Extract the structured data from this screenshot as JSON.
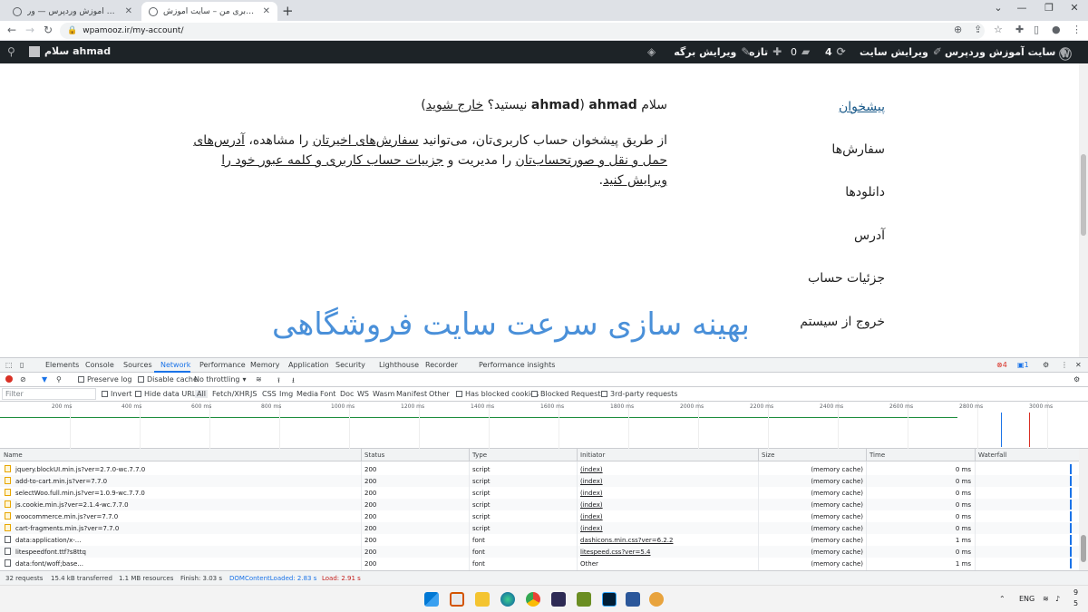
{
  "browser": {
    "tabs": [
      {
        "title": "کش‌ی ‹ سایت آموزش وردپرس — ور..."
      },
      {
        "title": "حساب کاربری من – سایت آموزش ..."
      }
    ],
    "new_tab": "+",
    "url": "wpamooz.ir/my-account/"
  },
  "wp_admin_bar": {
    "site_name": "سایت آموزش وردپرس",
    "customize": "ویرایش سایت",
    "updates": "4",
    "comments": "0",
    "new": "تازه",
    "edit_page": "ویرایش برگه",
    "howdy": "سلام ahmad"
  },
  "account": {
    "greeting_prefix": "سلام ",
    "username": "ahmad",
    "greeting_mid": " (",
    "username2": "ahmad",
    "not_you": " نیستید؟ ",
    "logout_link": "خارج شوید",
    "greeting_end": ")",
    "para_1": "از طریق پیشخوان حساب کاربری‌تان، می‌توانید ",
    "link_orders": "سفارش‌های اخیرتان",
    "para_2": " را مشاهده، ",
    "link_addresses": "آدرس‌های حمل و نقل و صورتحساب‌تان",
    "para_3": " را مدیریت و ",
    "link_details": "جزییات حساب کاربری و کلمه عبور خود را ویرایش کنید",
    "para_4": ".",
    "menu": [
      {
        "label": "پیشخوان"
      },
      {
        "label": "سفارش‌ها"
      },
      {
        "label": "دانلودها"
      },
      {
        "label": "آدرس"
      },
      {
        "label": "جزئیات حساب"
      },
      {
        "label": "خروج از سیستم"
      }
    ]
  },
  "overlay_title": "بهینه سازی سرعت سایت فروشگاهی",
  "devtools": {
    "tabs": [
      "Elements",
      "Console",
      "Sources",
      "Network",
      "Performance",
      "Memory",
      "Application",
      "Security",
      "Lighthouse",
      "Recorder",
      "Performance insights"
    ],
    "errors": "4",
    "messages": "1",
    "toolbar": {
      "preserve_log": "Preserve log",
      "disable_cache": "Disable cache",
      "throttling": "No throttling"
    },
    "filter": {
      "placeholder": "Filter",
      "invert": "Invert",
      "hide_data_urls": "Hide data URLs",
      "types": [
        "All",
        "Fetch/XHR",
        "JS",
        "CSS",
        "Img",
        "Media",
        "Font",
        "Doc",
        "WS",
        "Wasm",
        "Manifest",
        "Other"
      ],
      "blocked_cookies": "Has blocked cookies",
      "blocked_requests": "Blocked Requests",
      "third_party": "3rd-party requests"
    },
    "timeline_ticks": [
      "200 ms",
      "400 ms",
      "600 ms",
      "800 ms",
      "1000 ms",
      "1200 ms",
      "1400 ms",
      "1600 ms",
      "1800 ms",
      "2000 ms",
      "2200 ms",
      "2400 ms",
      "2600 ms",
      "2800 ms",
      "3000 ms"
    ],
    "columns": [
      "Name",
      "Status",
      "Type",
      "Initiator",
      "Size",
      "Time",
      "Waterfall"
    ],
    "rows": [
      {
        "name": "jquery.blockUI.min.js?ver=2.7.0-wc.7.7.0",
        "status": "200",
        "type": "script",
        "initiator": "(index)",
        "size": "(memory cache)",
        "time": "0 ms",
        "kind": "script"
      },
      {
        "name": "add-to-cart.min.js?ver=7.7.0",
        "status": "200",
        "type": "script",
        "initiator": "(index)",
        "size": "(memory cache)",
        "time": "0 ms",
        "kind": "script"
      },
      {
        "name": "selectWoo.full.min.js?ver=1.0.9-wc.7.7.0",
        "status": "200",
        "type": "script",
        "initiator": "(index)",
        "size": "(memory cache)",
        "time": "0 ms",
        "kind": "script"
      },
      {
        "name": "js.cookie.min.js?ver=2.1.4-wc.7.7.0",
        "status": "200",
        "type": "script",
        "initiator": "(index)",
        "size": "(memory cache)",
        "time": "0 ms",
        "kind": "script"
      },
      {
        "name": "woocommerce.min.js?ver=7.7.0",
        "status": "200",
        "type": "script",
        "initiator": "(index)",
        "size": "(memory cache)",
        "time": "0 ms",
        "kind": "script"
      },
      {
        "name": "cart-fragments.min.js?ver=7.7.0",
        "status": "200",
        "type": "script",
        "initiator": "(index)",
        "size": "(memory cache)",
        "time": "0 ms",
        "kind": "script"
      },
      {
        "name": "data:application/x-...",
        "status": "200",
        "type": "font",
        "initiator": "dashicons.min.css?ver=6.2.2",
        "size": "(memory cache)",
        "time": "1 ms",
        "kind": "font"
      },
      {
        "name": "litespeedfont.ttf?s8ttq",
        "status": "200",
        "type": "font",
        "initiator": "litespeed.css?ver=5.4",
        "size": "(memory cache)",
        "time": "0 ms",
        "kind": "font"
      },
      {
        "name": "data:font/woff;base...",
        "status": "200",
        "type": "font",
        "initiator": "Other",
        "size": "(memory cache)",
        "time": "1 ms",
        "kind": "font"
      }
    ],
    "status_bar": {
      "requests": "32 requests",
      "transferred": "15.4 kB transferred",
      "resources": "1.1 MB resources",
      "finish": "Finish: 3.03 s",
      "dom_loaded": "DOMContentLoaded: 2.83 s",
      "load": "Load: 2.91 s"
    }
  },
  "taskbar": {
    "lang": "ENG",
    "time": "9",
    "date": "5"
  }
}
